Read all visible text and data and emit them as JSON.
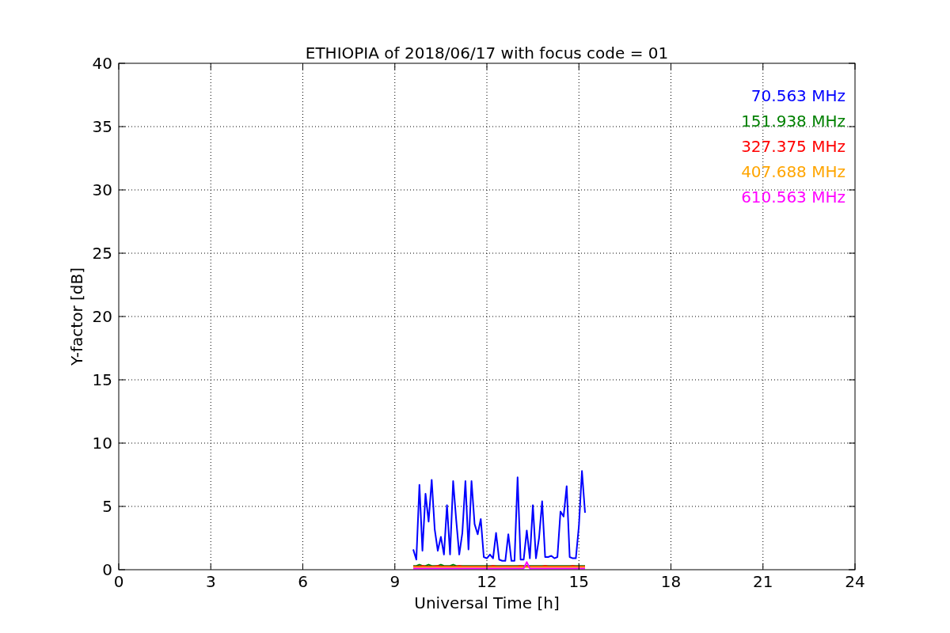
{
  "figure": {
    "chart_data": {
      "type": "line",
      "title": "ETHIOPIA of 2018/06/17 with focus code = 01",
      "xlabel": "Universal Time [h]",
      "ylabel": "Y-factor [dB]",
      "grid": true,
      "xlim": [
        0,
        24
      ],
      "ylim": [
        0,
        40
      ],
      "xticks": [
        0,
        3,
        6,
        9,
        12,
        15,
        18,
        21,
        24
      ],
      "yticks": [
        0,
        5,
        10,
        15,
        20,
        25,
        30,
        35,
        40
      ],
      "x": [
        9.6,
        9.7,
        9.8,
        9.9,
        10.0,
        10.1,
        10.2,
        10.3,
        10.4,
        10.5,
        10.6,
        10.7,
        10.8,
        10.9,
        11.0,
        11.1,
        11.2,
        11.3,
        11.4,
        11.5,
        11.6,
        11.7,
        11.8,
        11.9,
        12.0,
        12.1,
        12.2,
        12.3,
        12.4,
        12.5,
        12.6,
        12.7,
        12.8,
        12.9,
        13.0,
        13.1,
        13.2,
        13.3,
        13.4,
        13.5,
        13.6,
        13.7,
        13.8,
        13.9,
        14.0,
        14.1,
        14.2,
        14.3,
        14.4,
        14.5,
        14.6,
        14.7,
        14.8,
        14.9,
        15.0,
        15.1,
        15.2
      ],
      "series": [
        {
          "name": "70.563 MHz",
          "color": "#0000ff",
          "values": [
            1.6,
            0.8,
            6.7,
            1.5,
            6.0,
            3.8,
            7.1,
            3.2,
            1.5,
            2.6,
            1.2,
            5.1,
            1.2,
            7.0,
            3.9,
            1.2,
            2.9,
            7.0,
            1.6,
            7.0,
            3.6,
            2.8,
            4.0,
            1.0,
            0.9,
            1.2,
            0.9,
            2.9,
            0.8,
            0.7,
            0.7,
            2.8,
            0.7,
            0.7,
            7.3,
            0.8,
            0.8,
            3.1,
            0.9,
            5.1,
            0.9,
            2.5,
            5.4,
            1.0,
            1.0,
            1.1,
            0.9,
            1.0,
            4.6,
            4.2,
            6.6,
            1.0,
            0.9,
            0.9,
            3.5,
            7.8,
            4.5
          ]
        },
        {
          "name": "151.938 MHz",
          "color": "#008000",
          "values": [
            0.3,
            0.3,
            0.4,
            0.3,
            0.3,
            0.4,
            0.3,
            0.3,
            0.3,
            0.4,
            0.3,
            0.3,
            0.3,
            0.4,
            0.3,
            0.3,
            0.3,
            0.3,
            0.3,
            0.3,
            0.3,
            0.3,
            0.3,
            0.3,
            0.3,
            0.3,
            0.3,
            0.3,
            0.3,
            0.3,
            0.3,
            0.3,
            0.3,
            0.3,
            0.3,
            0.3,
            0.3,
            0.3,
            0.3,
            0.3,
            0.3,
            0.3,
            0.3,
            0.3,
            0.3,
            0.3,
            0.3,
            0.3,
            0.3,
            0.3,
            0.3,
            0.3,
            0.3,
            0.3,
            0.3,
            0.3,
            0.3
          ]
        },
        {
          "name": "327.375 MHz",
          "color": "#ff0000",
          "values": [
            0.25,
            0.25,
            0.25,
            0.3,
            0.25,
            0.25,
            0.25,
            0.25,
            0.3,
            0.25,
            0.25,
            0.25,
            0.25,
            0.25,
            0.25,
            0.3,
            0.25,
            0.25,
            0.25,
            0.25,
            0.25,
            0.25,
            0.25,
            0.25,
            0.25,
            0.25,
            0.3,
            0.25,
            0.25,
            0.25,
            0.25,
            0.25,
            0.25,
            0.25,
            0.25,
            0.3,
            0.25,
            0.25,
            0.25,
            0.25,
            0.25,
            0.25,
            0.25,
            0.3,
            0.25,
            0.25,
            0.25,
            0.25,
            0.25,
            0.25,
            0.25,
            0.25,
            0.3,
            0.25,
            0.25,
            0.25,
            0.25
          ]
        },
        {
          "name": "407.688 MHz",
          "color": "#ffa500",
          "values": [
            0.2,
            0.2,
            0.2,
            0.2,
            0.2,
            0.2,
            0.2,
            0.2,
            0.2,
            0.2,
            0.2,
            0.2,
            0.2,
            0.2,
            0.2,
            0.2,
            0.2,
            0.2,
            0.2,
            0.2,
            0.2,
            0.2,
            0.2,
            0.2,
            0.2,
            0.2,
            0.2,
            0.2,
            0.2,
            0.2,
            0.2,
            0.2,
            0.2,
            0.2,
            0.2,
            0.2,
            0.2,
            0.2,
            0.2,
            0.2,
            0.2,
            0.2,
            0.2,
            0.2,
            0.2,
            0.2,
            0.2,
            0.2,
            0.2,
            0.2,
            0.2,
            0.2,
            0.2,
            0.2,
            0.2,
            0.2,
            0.2
          ]
        },
        {
          "name": "610.563 MHz",
          "color": "#ff00ff",
          "values": [
            0.1,
            0.1,
            0.1,
            0.1,
            0.1,
            0.1,
            0.1,
            0.1,
            0.1,
            0.1,
            0.1,
            0.1,
            0.1,
            0.1,
            0.1,
            0.1,
            0.1,
            0.1,
            0.1,
            0.1,
            0.1,
            0.1,
            0.1,
            0.1,
            0.1,
            0.1,
            0.1,
            0.1,
            0.1,
            0.1,
            0.1,
            0.1,
            0.1,
            0.1,
            0.1,
            0.1,
            0.1,
            0.6,
            0.1,
            0.1,
            0.1,
            0.1,
            0.1,
            0.1,
            0.1,
            0.1,
            0.1,
            0.1,
            0.1,
            0.1,
            0.1,
            0.1,
            0.1,
            0.1,
            0.1,
            0.1,
            0.1
          ]
        }
      ]
    }
  }
}
